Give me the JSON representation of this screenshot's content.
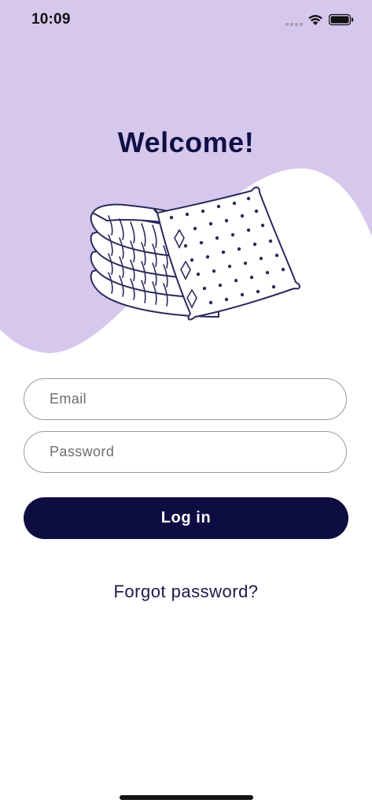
{
  "status_bar": {
    "time": "10:09",
    "icons": [
      "signal-icon",
      "wifi-icon",
      "battery-icon"
    ]
  },
  "hero": {
    "title": "Welcome!",
    "illustration": "towels-and-pillow-illustration",
    "background_color": "#d6c8ec"
  },
  "form": {
    "email": {
      "placeholder": "Email",
      "value": ""
    },
    "password": {
      "placeholder": "Password",
      "value": ""
    },
    "login_label": "Log in",
    "forgot_label": "Forgot password?"
  },
  "colors": {
    "primary": "#0d0d42",
    "hero": "#d6c8ec",
    "text_dark": "#0f0f45"
  }
}
